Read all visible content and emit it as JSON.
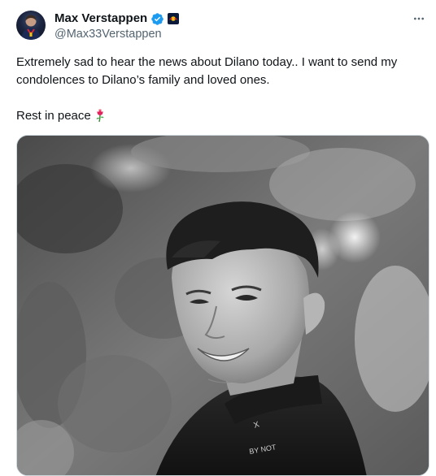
{
  "tweet": {
    "author": {
      "display_name": "Max Verstappen",
      "handle": "@Max33Verstappen",
      "verified": true,
      "avatar_icon": "avatar-photo-icon",
      "affiliate_icon": "red-bull-badge-icon"
    },
    "more_icon": "more-options-icon",
    "text_line_1": "Extremely sad to hear the news about Dilano today.. I want to send my condolences to Dilano’s family and loved ones.",
    "text_line_2": "Rest in peace",
    "emoji_icon": "rose-emoji-icon",
    "media": {
      "type": "photo",
      "style": "black-and-white"
    }
  },
  "colors": {
    "text_primary": "#0f1419",
    "text_secondary": "#536471",
    "verified_blue": "#1d9bf0",
    "border": "#cfd9de"
  }
}
